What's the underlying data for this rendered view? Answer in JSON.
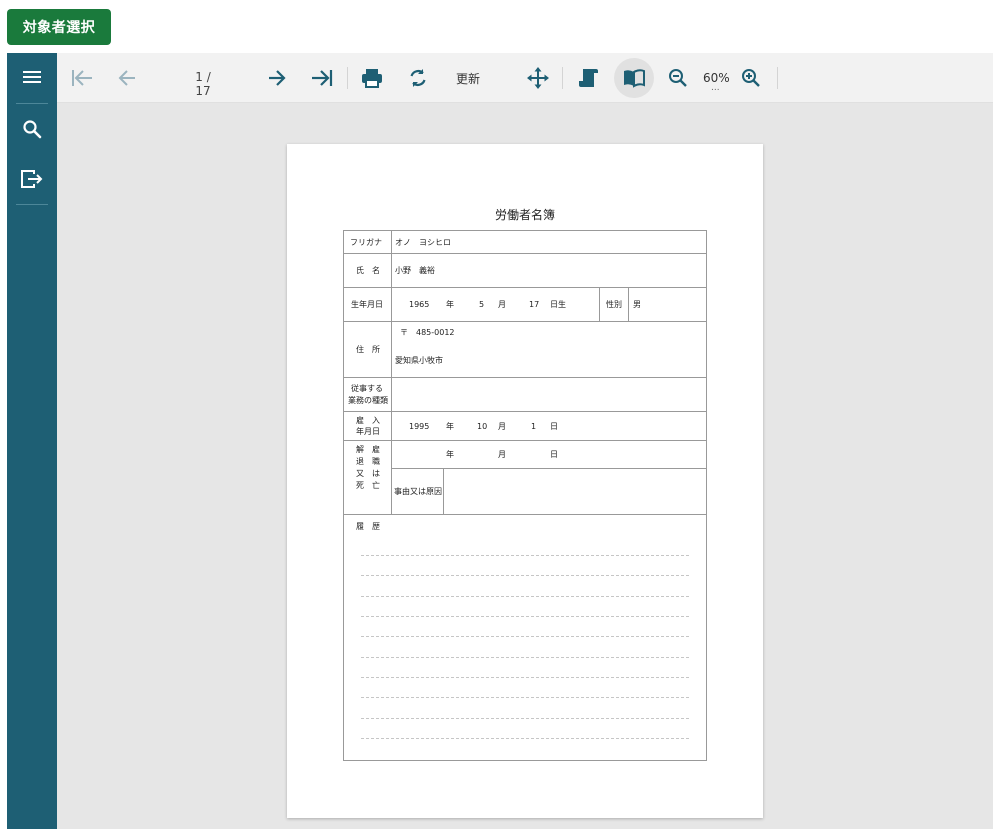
{
  "top": {
    "select_button": "対象者選択"
  },
  "sidebar": {
    "items": [
      "menu-icon",
      "search-icon",
      "export-icon"
    ]
  },
  "toolbar": {
    "pager": "1 / 17",
    "refresh_label": "更新",
    "zoom": "60%",
    "zoom_dots": "...",
    "icons": [
      "first-page-icon",
      "prev-page-icon",
      "next-page-icon",
      "last-page-icon",
      "print-icon",
      "reload-icon",
      "pan-icon",
      "continuous-scroll-icon",
      "book-view-icon",
      "zoom-out-icon",
      "zoom-in-icon"
    ]
  },
  "document": {
    "title": "労働者名簿",
    "furigana": {
      "label": "フリガナ",
      "value": "オノ　ヨシヒロ"
    },
    "name": {
      "label": "氏　名",
      "value": "小野　義裕"
    },
    "birth": {
      "label": "生年月日",
      "year": "1965",
      "year_unit": "年",
      "month": "5",
      "month_unit": "月",
      "day": "17",
      "day_unit": "日生"
    },
    "gender": {
      "label": "性別",
      "value": "男"
    },
    "address": {
      "label": "住　所",
      "postal": "〒　485-0012",
      "value": "愛知県小牧市"
    },
    "job": {
      "label_line1": "従事する",
      "label_line2": "業務の種類",
      "value": ""
    },
    "hire": {
      "label_line1": "雇　入",
      "label_line2": "年月日",
      "year": "1995",
      "year_unit": "年",
      "month": "10",
      "month_unit": "月",
      "day": "1",
      "day_unit": "日"
    },
    "leave": {
      "label_lines": [
        "解　雇",
        "退　職",
        "又　は",
        "死　亡"
      ],
      "year_unit": "年",
      "month_unit": "月",
      "day_unit": "日",
      "reason_label": "事由又は原因",
      "reason_value": ""
    },
    "history": {
      "label": "履　歴"
    }
  },
  "colors": {
    "sidebar": "#1e5f74",
    "accent_button": "#1a7a3c",
    "toolbar_bg": "#f2f2f2",
    "viewer_bg": "#e6e6e6"
  }
}
